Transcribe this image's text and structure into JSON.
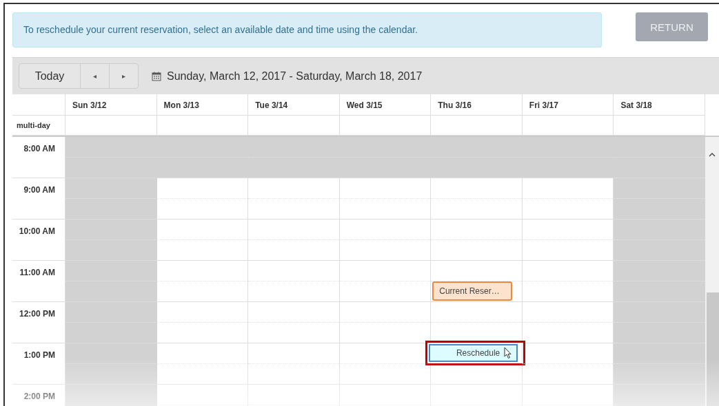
{
  "notice": {
    "text": "To reschedule your current reservation, select an available date and time using the calendar."
  },
  "return_button": {
    "label": "RETURN",
    "disabled": true
  },
  "toolbar": {
    "today_button": "Today",
    "prev_button": "◂",
    "next_button": "▸",
    "date_range": "Sunday, March 12, 2017 - Saturday, March 18, 2017"
  },
  "calendar": {
    "columns": [
      "Sun 3/12",
      "Mon 3/13",
      "Tue 3/14",
      "Wed 3/15",
      "Thu 3/16",
      "Fri 3/17",
      "Sat 3/18"
    ],
    "multi_day_label": "multi-day",
    "rows": [
      {
        "time": "8:00 AM",
        "cells": [
          {
            "available": false
          },
          {
            "available": false
          },
          {
            "available": false
          },
          {
            "available": false
          },
          {
            "available": false
          },
          {
            "available": false
          },
          {
            "available": false
          }
        ]
      },
      {
        "time": "9:00 AM",
        "cells": [
          {
            "available": false
          },
          {
            "available": true
          },
          {
            "available": true
          },
          {
            "available": true
          },
          {
            "available": true
          },
          {
            "available": true
          },
          {
            "available": false
          }
        ]
      },
      {
        "time": "10:00 AM",
        "cells": [
          {
            "available": false
          },
          {
            "available": true
          },
          {
            "available": true
          },
          {
            "available": true
          },
          {
            "available": true
          },
          {
            "available": true
          },
          {
            "available": false
          }
        ]
      },
      {
        "time": "11:00 AM",
        "cells": [
          {
            "available": false
          },
          {
            "available": true
          },
          {
            "available": true
          },
          {
            "available": true
          },
          {
            "available": true,
            "events": [
              {
                "kind": "current",
                "label": "Current Reser…",
                "highlighted": false
              }
            ]
          },
          {
            "available": true
          },
          {
            "available": false
          }
        ]
      },
      {
        "time": "12:00 PM",
        "cells": [
          {
            "available": false
          },
          {
            "available": true
          },
          {
            "available": true
          },
          {
            "available": true
          },
          {
            "available": true
          },
          {
            "available": true
          },
          {
            "available": false
          }
        ]
      },
      {
        "time": "1:00 PM",
        "cells": [
          {
            "available": false
          },
          {
            "available": true
          },
          {
            "available": true
          },
          {
            "available": true
          },
          {
            "available": true,
            "events": [
              {
                "kind": "reschedule",
                "label": "Reschedule",
                "highlighted": true
              }
            ]
          },
          {
            "available": true
          },
          {
            "available": false
          }
        ]
      },
      {
        "time": "2:00 PM",
        "cells": [
          {
            "available": false
          },
          {
            "available": true
          },
          {
            "available": true
          },
          {
            "available": true
          },
          {
            "available": true
          },
          {
            "available": true
          },
          {
            "available": false
          }
        ]
      }
    ]
  }
}
